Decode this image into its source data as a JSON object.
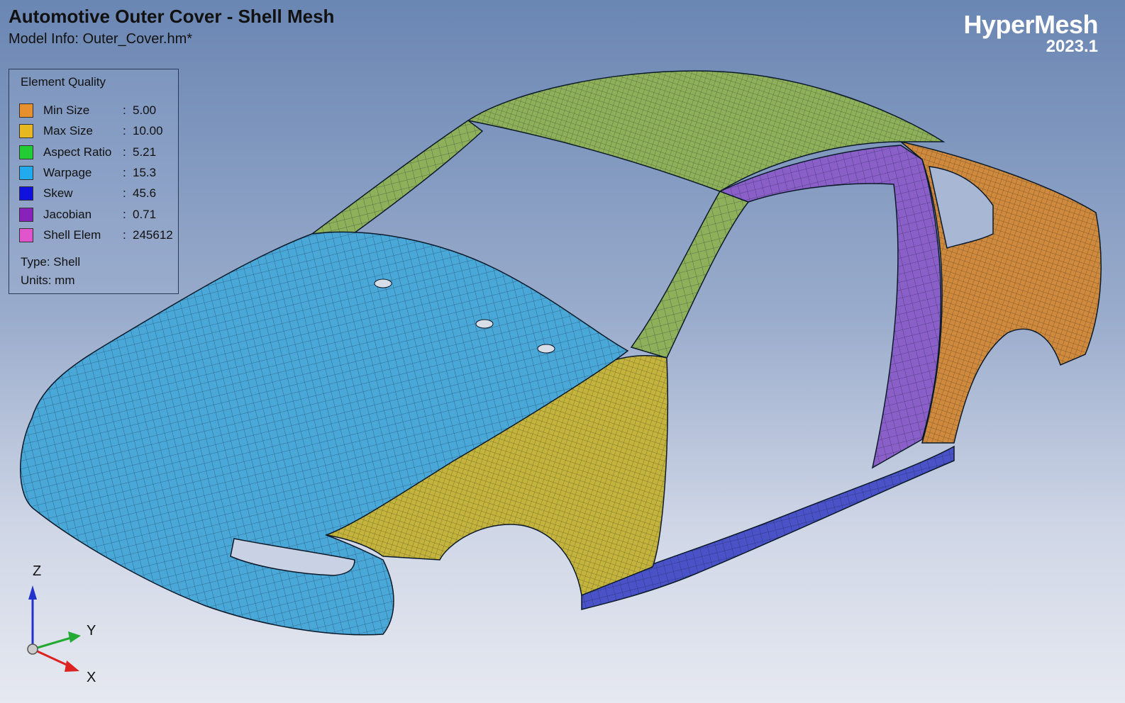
{
  "header": {
    "title": "Automotive Outer Cover - Shell Mesh",
    "model_info": "Model Info: Outer_Cover.hm*"
  },
  "brand": {
    "name": "HyperMesh",
    "version": "2023.1"
  },
  "legend": {
    "title": "Element Quality",
    "items": [
      {
        "label": "Min Size",
        "value": "5.00",
        "color": "#e8902e"
      },
      {
        "label": "Max Size",
        "value": "10.00",
        "color": "#e8b820"
      },
      {
        "label": "Aspect Ratio",
        "value": "5.21",
        "color": "#22cc33"
      },
      {
        "label": "Warpage",
        "value": "15.3",
        "color": "#22aaee"
      },
      {
        "label": "Skew",
        "value": "45.6",
        "color": "#1111dd"
      },
      {
        "label": "Jacobian",
        "value": "0.71",
        "color": "#8822bb"
      },
      {
        "label": "Shell Elem",
        "value": "245612",
        "color": "#e055cc"
      }
    ],
    "type_text": "Type: Shell",
    "units_text": "Units: mm"
  },
  "axes": {
    "z": "Z",
    "y": "Y",
    "x": "X"
  },
  "mesh_colors": {
    "hood": "#4aa8d8",
    "roof": "#8fb05a",
    "fender": "#c4b43e",
    "pillar": "#8a5fc8",
    "rear_quarter": "#cf8a3e",
    "sill": "#4a52c8"
  }
}
